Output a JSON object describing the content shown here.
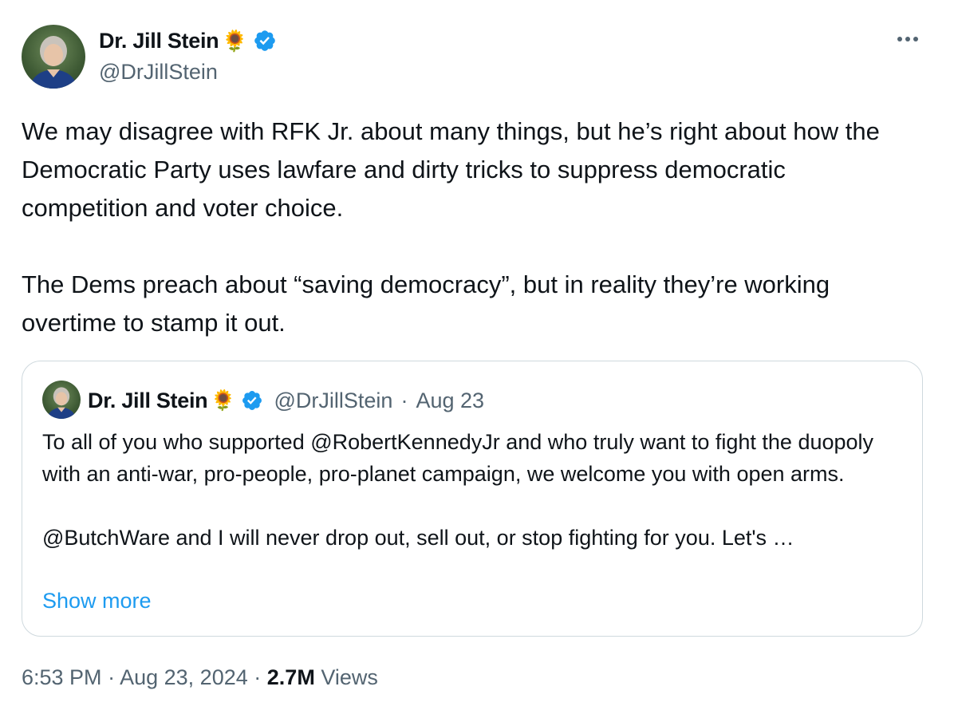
{
  "author": {
    "display_name": "Dr. Jill Stein",
    "name_emoji": "🌻",
    "handle": "@DrJillStein",
    "verified_icon": "verified-badge-icon"
  },
  "post": {
    "paragraphs": [
      "We may disagree with RFK Jr. about many things, but he’s right about how the Democratic Party uses lawfare and dirty tricks to suppress democratic competition and voter choice.",
      "The Dems preach about “saving democracy”, but in reality they’re working overtime to stamp it out."
    ]
  },
  "quoted_post": {
    "display_name": "Dr. Jill Stein",
    "name_emoji": "🌻",
    "handle": "@DrJillStein",
    "separator": "·",
    "date": "Aug 23",
    "paragraphs": [
      "To all of you who supported @RobertKennedyJr  and who truly want to fight the duopoly with an anti-war, pro-people, pro-planet campaign, we welcome you with open arms.",
      "@ButchWare and I will never drop out, sell out, or stop fighting for you. Let's …"
    ],
    "show_more_label": "Show more"
  },
  "footer": {
    "time": "6:53 PM",
    "separator1": "·",
    "date": "Aug 23, 2024",
    "separator2": "·",
    "views_count": "2.7M",
    "views_label": "Views"
  },
  "colors": {
    "text_primary": "#0f1419",
    "text_secondary": "#536471",
    "link": "#1d9bf0",
    "border": "#cfd9de",
    "verified": "#1d9bf0"
  }
}
